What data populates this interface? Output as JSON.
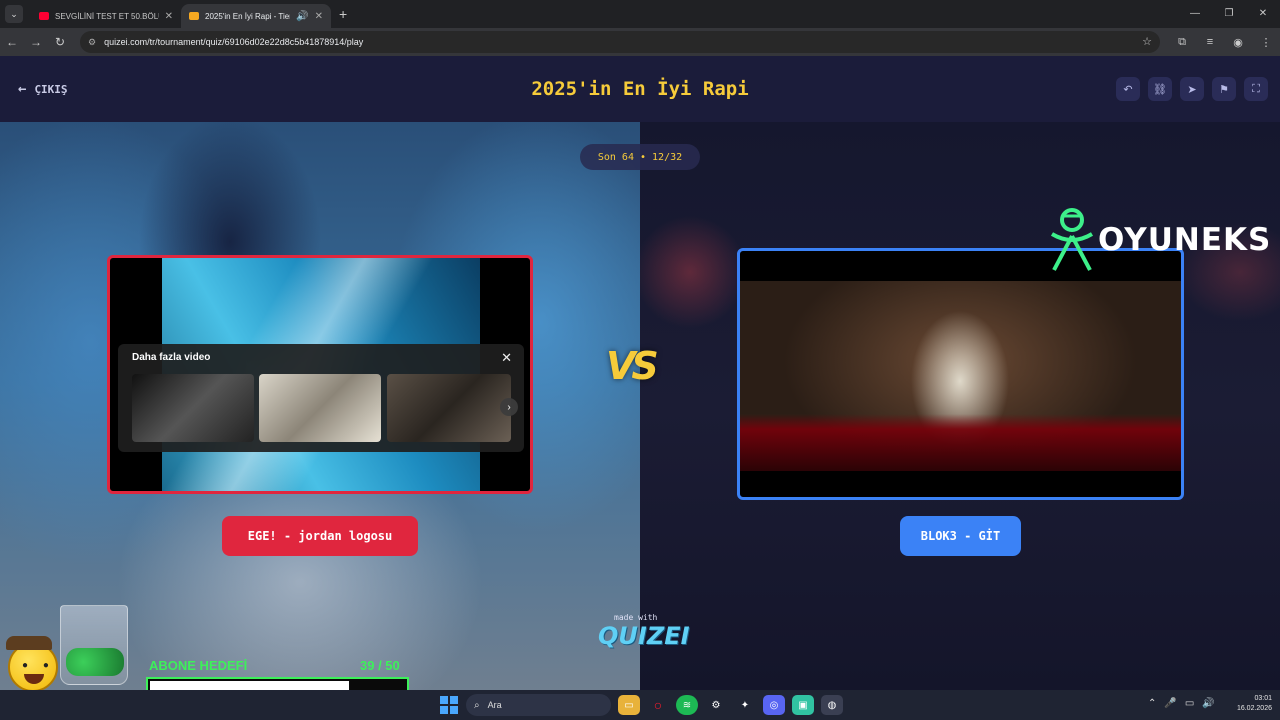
{
  "browser": {
    "tabs": [
      {
        "title": "SEVGİLİNİ TEST ET 50.BÖLÜM -",
        "favicon_color": "#ff0033"
      },
      {
        "title": "2025'in En İyi Rapi - Tier Lis",
        "favicon_color": "#f6a821"
      }
    ],
    "url": "quizei.com/tr/tournament/quiz/69106d02e22d8c5b41878914/play"
  },
  "quiz": {
    "exit_label": "ÇIKIŞ",
    "title": "2025'in En İyi Rapi",
    "round": "Son 64 • 12/32",
    "vs": "VS",
    "left": {
      "name": "EGE! - jordan logosu",
      "overlay_title": "Daha fazla video",
      "border_color": "#e0263e"
    },
    "right": {
      "name": "BLOK3 - GİT",
      "border_color": "#3b82f6"
    },
    "made_with": "made with",
    "brand": "QUIZEI"
  },
  "watermark": {
    "text": "OYUNEKS"
  },
  "subscriber_goal": {
    "label": "ABONE HEDEFİ",
    "current": 39,
    "target": 50,
    "count_text": "39  / 50"
  },
  "taskbar": {
    "search_placeholder": "Ara",
    "time": "03:01",
    "date": "16.02.2026"
  },
  "colors": {
    "title_yellow": "#f6cb3a",
    "left_red": "#e0263e",
    "right_blue": "#3b82f6",
    "goal_green": "#3df05a"
  }
}
